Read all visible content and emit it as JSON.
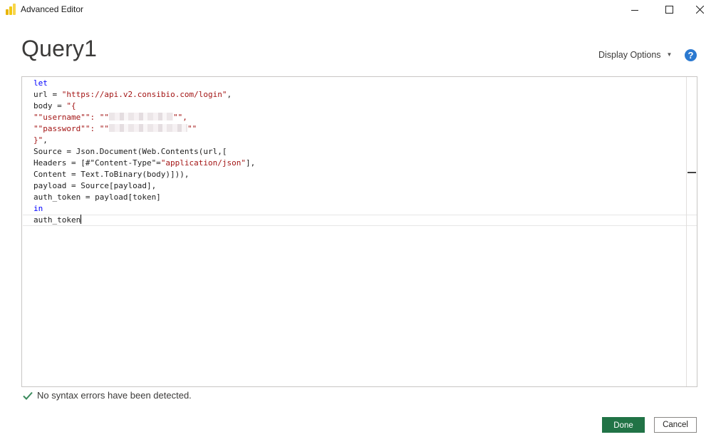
{
  "window": {
    "title": "Advanced Editor",
    "icon": "power-bi-icon",
    "controls": [
      "minimize",
      "maximize",
      "close"
    ]
  },
  "header": {
    "query_name": "Query1",
    "display_options_label": "Display Options",
    "help_label": "?"
  },
  "editor": {
    "lines": {
      "l1": "let",
      "l2_a": "url = ",
      "l2_str": "\"https://api.v2.consibio.com/login\"",
      "l2_b": ",",
      "l3_a": "body = ",
      "l3_str": "\"{",
      "l4_str": "\"\"username\"\": \"\"",
      "l4_end": "\"\",",
      "l5_str": "\"\"password\"\": \"\"",
      "l5_end": "\"\"",
      "l6_str": "}\"",
      "l6_b": ",",
      "l7": "Source = Json.Document(Web.Contents(url,[",
      "l8_a": "Headers = [#\"Content-Type\"=",
      "l8_str": "\"application/json\"",
      "l8_b": "],",
      "l9": "Content = Text.ToBinary(body)])),",
      "l10": "payload = Source[payload],",
      "l11": "auth_token = payload[token]",
      "l12": "in",
      "l13": "auth_token"
    },
    "colors": {
      "keyword": "#0000ff",
      "string": "#a31515"
    }
  },
  "status": {
    "icon": "checkmark-icon",
    "text": "No syntax errors have been detected."
  },
  "buttons": {
    "done": "Done",
    "cancel": "Cancel"
  },
  "colors": {
    "accent": "#217346",
    "help": "#2b79d0"
  }
}
